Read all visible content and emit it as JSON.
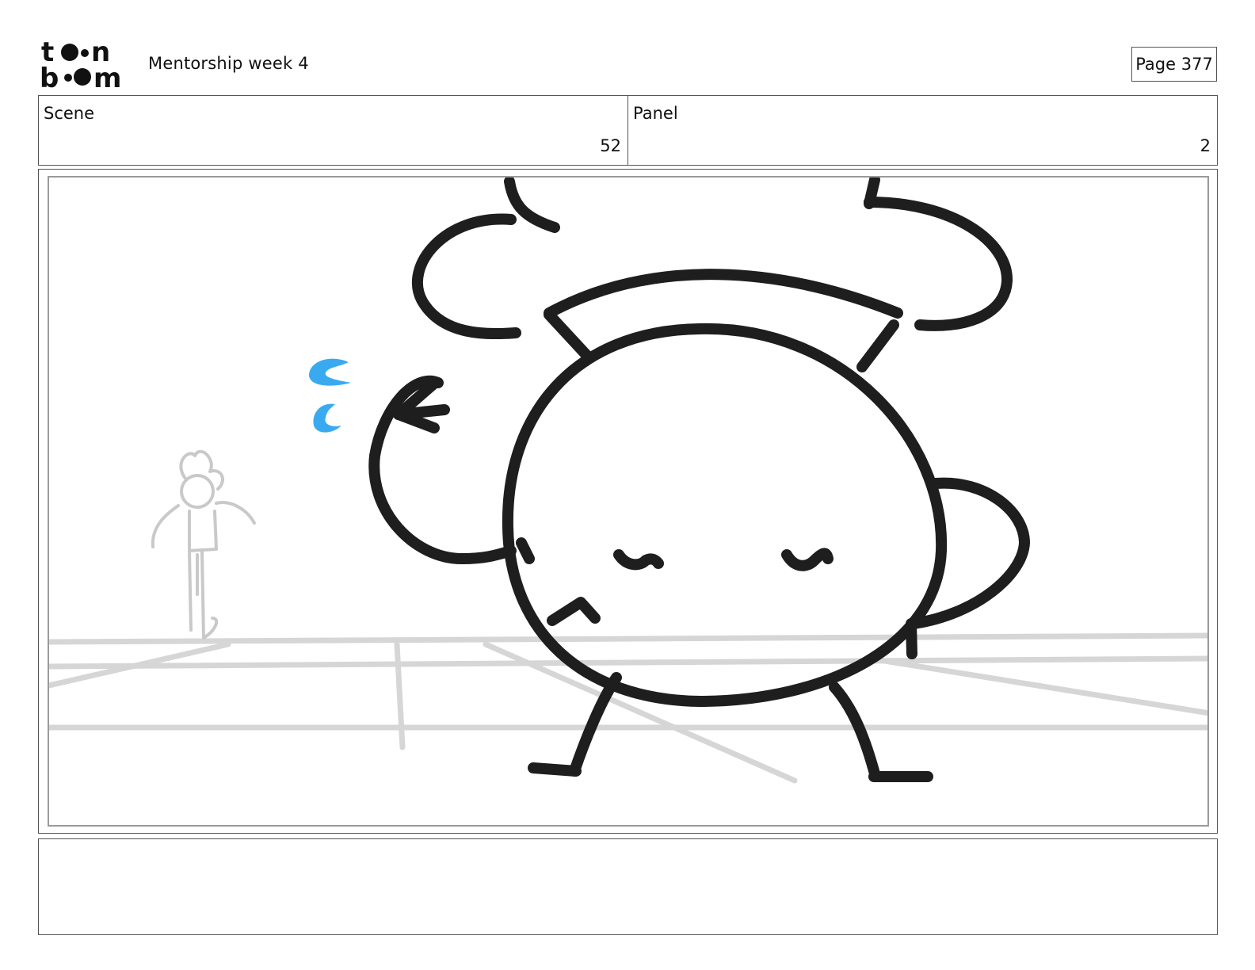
{
  "logo": {
    "line1": "toon",
    "line2": "boom",
    "icon": "toon-boom-logo"
  },
  "header": {
    "title": "Mentorship week 4",
    "page_label": "Page",
    "page_number": "377"
  },
  "info": {
    "scene_label": "Scene",
    "scene_value": "52",
    "panel_label": "Panel",
    "panel_value": "2"
  },
  "panel": {
    "description": "",
    "colors": {
      "ink": "#1e1e1e",
      "rough": "#c9c9c9",
      "floor": "#d6d6d6",
      "sweat": "#3aaaf0"
    }
  },
  "notes": {
    "text": ""
  }
}
